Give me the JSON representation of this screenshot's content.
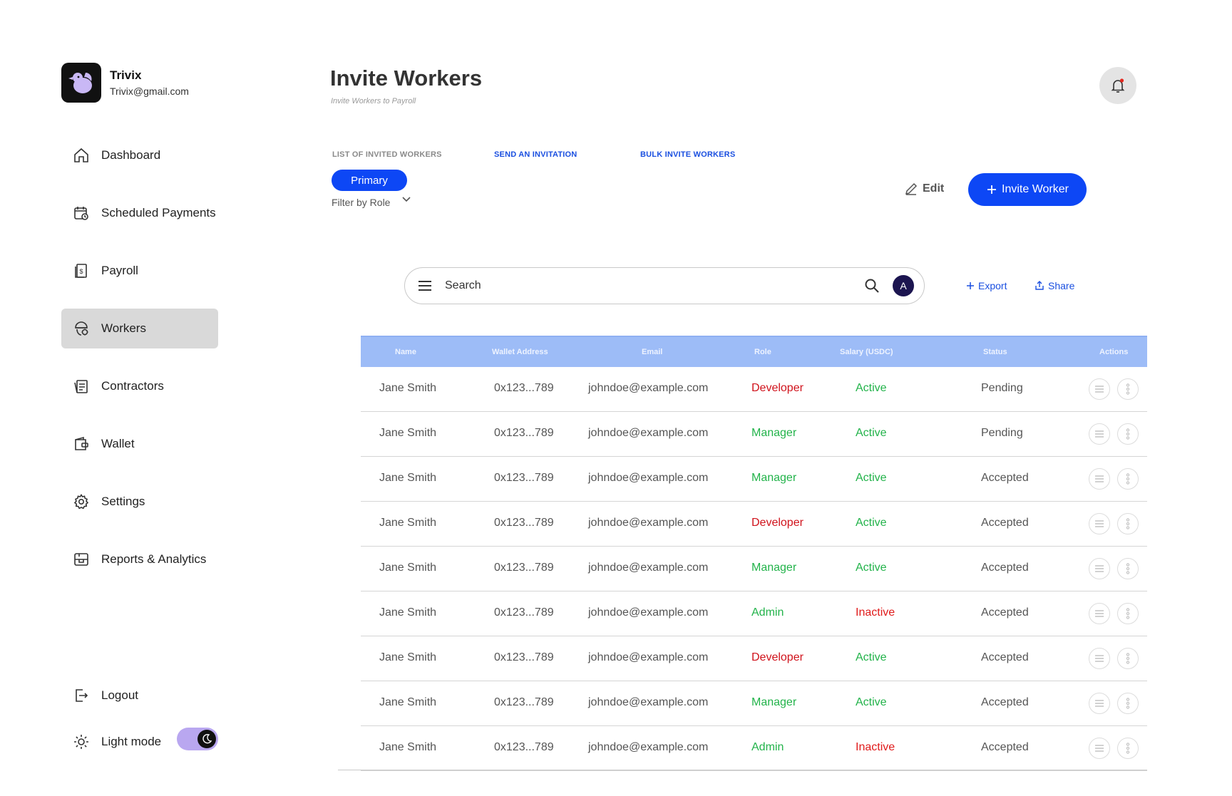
{
  "brand": {
    "name": "Trivix",
    "email": "Trivix@gmail.com"
  },
  "sidebar": {
    "items": [
      {
        "label": "Dashboard",
        "icon": "home-icon",
        "active": false
      },
      {
        "label": "Scheduled Payments",
        "icon": "calendar-icon",
        "active": false
      },
      {
        "label": "Payroll",
        "icon": "receipt-icon",
        "active": false
      },
      {
        "label": "Workers",
        "icon": "worker-icon",
        "active": true
      },
      {
        "label": "Contractors",
        "icon": "contract-icon",
        "active": false
      },
      {
        "label": "Wallet",
        "icon": "wallet-icon",
        "active": false
      },
      {
        "label": "Settings",
        "icon": "gear-icon",
        "active": false
      },
      {
        "label": "Reports & Analytics",
        "icon": "reports-icon",
        "active": false
      }
    ],
    "logout": "Logout",
    "theme_label": "Light mode"
  },
  "header": {
    "title": "Invite Workers",
    "subtitle": "Invite Workers to Payroll"
  },
  "tabs": {
    "list": "LIST OF INVITED WORKERS",
    "send": "SEND AN INVITATION",
    "bulk": "BULK INVITE WORKERS"
  },
  "filter": {
    "primary": "Primary",
    "label": "Filter by Role"
  },
  "toolbar": {
    "edit": "Edit",
    "invite": "Invite Worker",
    "export": "Export",
    "share": "Share"
  },
  "search": {
    "placeholder": "Search",
    "avatar": "A"
  },
  "table": {
    "headers": [
      "Name",
      "Wallet Address",
      "Email",
      "Role",
      "Salary (USDC)",
      "Status",
      "Actions"
    ],
    "rows": [
      {
        "name": "Jane Smith",
        "wallet": "0x123...789",
        "email": "johndoe@example.com",
        "role": "Developer",
        "salary": "Active",
        "status": "Pending"
      },
      {
        "name": "Jane Smith",
        "wallet": "0x123...789",
        "email": "johndoe@example.com",
        "role": "Manager",
        "salary": "Active",
        "status": "Pending"
      },
      {
        "name": "Jane Smith",
        "wallet": "0x123...789",
        "email": "johndoe@example.com",
        "role": "Manager",
        "salary": "Active",
        "status": "Accepted"
      },
      {
        "name": "Jane Smith",
        "wallet": "0x123...789",
        "email": "johndoe@example.com",
        "role": "Developer",
        "salary": "Active",
        "status": "Accepted"
      },
      {
        "name": "Jane Smith",
        "wallet": "0x123...789",
        "email": "johndoe@example.com",
        "role": "Manager",
        "salary": "Active",
        "status": "Accepted"
      },
      {
        "name": "Jane Smith",
        "wallet": "0x123...789",
        "email": "johndoe@example.com",
        "role": "Admin",
        "salary": "Inactive",
        "status": "Accepted"
      },
      {
        "name": "Jane Smith",
        "wallet": "0x123...789",
        "email": "johndoe@example.com",
        "role": "Developer",
        "salary": "Active",
        "status": "Accepted"
      },
      {
        "name": "Jane Smith",
        "wallet": "0x123...789",
        "email": "johndoe@example.com",
        "role": "Manager",
        "salary": "Active",
        "status": "Accepted"
      },
      {
        "name": "Jane Smith",
        "wallet": "0x123...789",
        "email": "johndoe@example.com",
        "role": "Admin",
        "salary": "Inactive",
        "status": "Accepted"
      }
    ]
  },
  "colors": {
    "accent": "#0d47f5",
    "table_header": "#9dbcf7",
    "role_developer": "#d0121b",
    "role_other": "#22b34a",
    "active": "#22b34a",
    "inactive": "#e01b1b",
    "toggle": "#b9a7f0"
  }
}
